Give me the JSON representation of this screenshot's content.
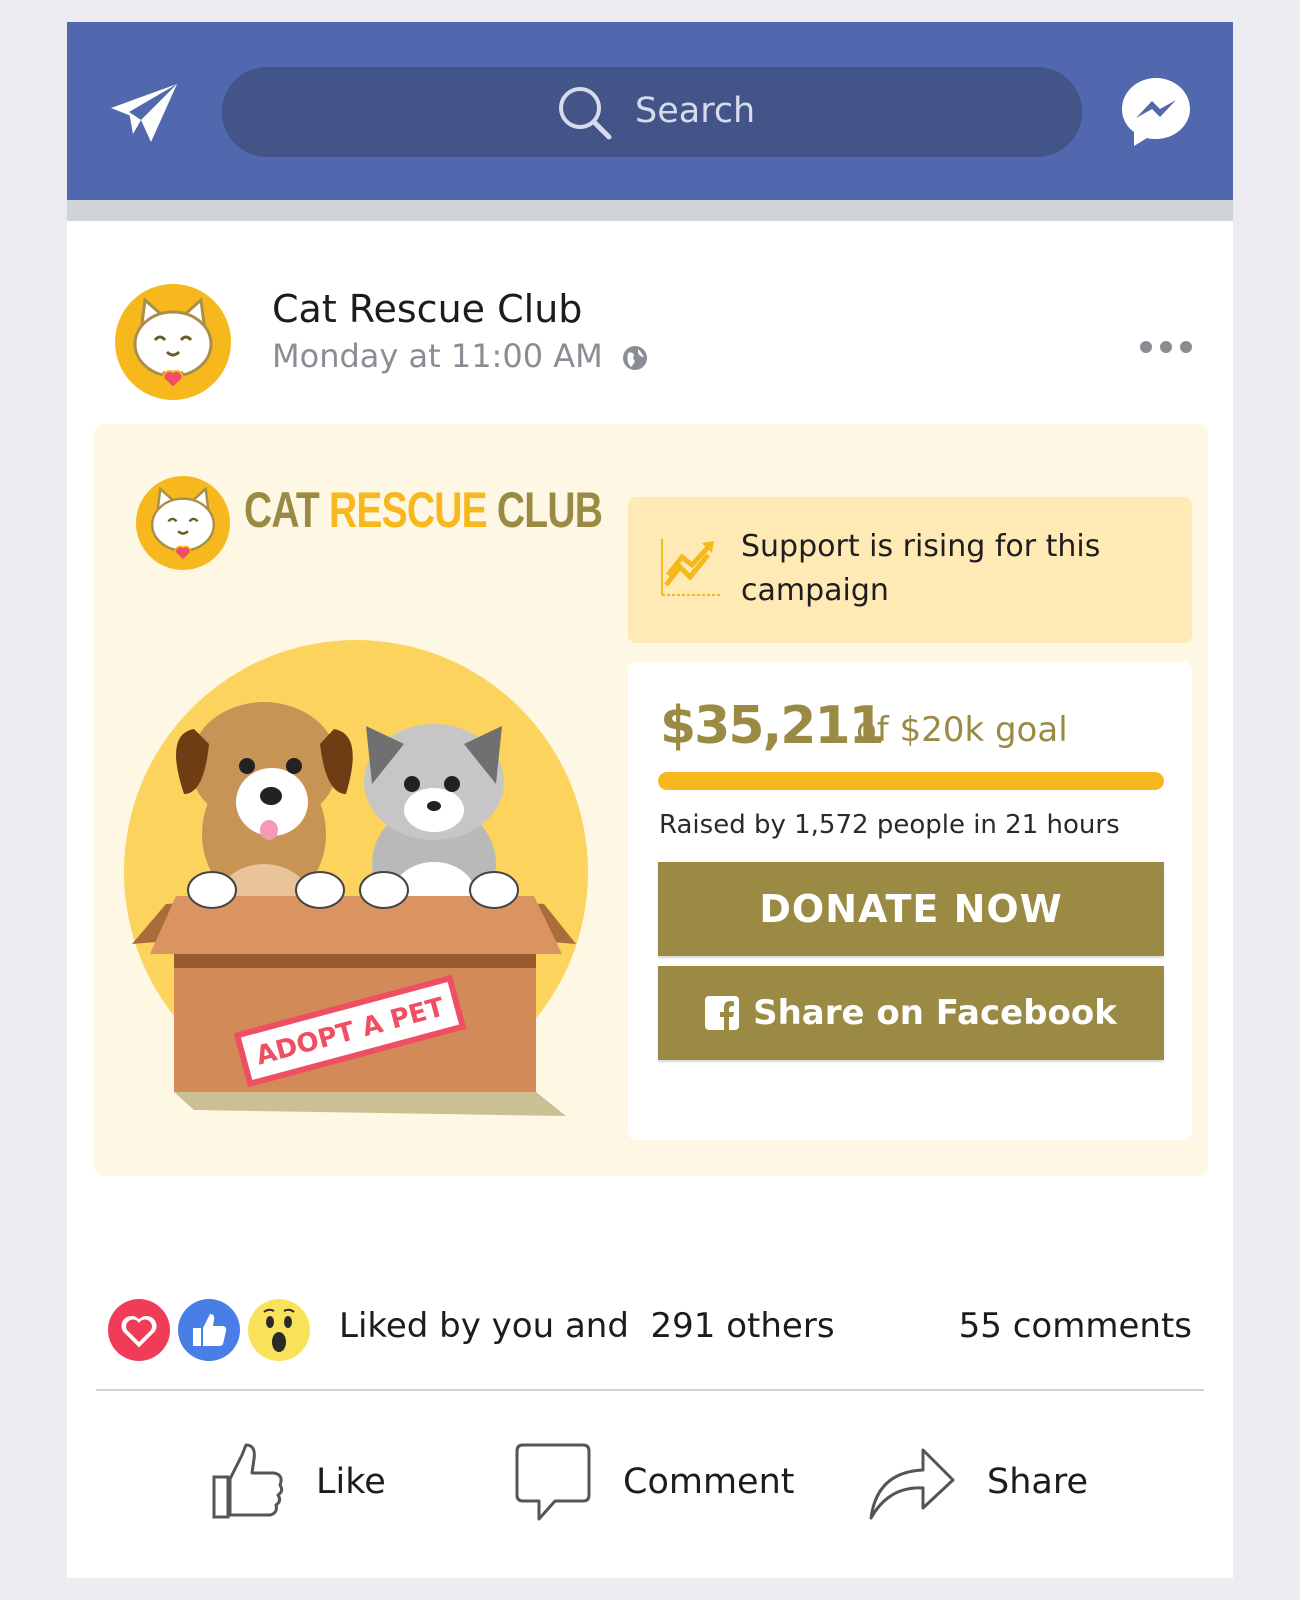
{
  "topbar": {
    "search_placeholder": "Search"
  },
  "post": {
    "page_name": "Cat Rescue Club",
    "timestamp": "Monday at 11:00 AM"
  },
  "banner": {
    "brand_word1": "CAT",
    "brand_word2": "RESCUE",
    "brand_word3": "CLUB",
    "stamp_text": "ADOPT A PET",
    "rising_text": "Support is rising for this campaign",
    "amount": "$35,211",
    "goal": "of $20k goal",
    "progress_fraction": 1.0,
    "raised_text": "Raised by 1,572 people in 21 hours",
    "donate_label": "DONATE NOW",
    "share_fb_label": "Share on Facebook"
  },
  "engagement": {
    "liked_text": "Liked by you and  291 others",
    "comments_text": "55 comments"
  },
  "actions": {
    "like": "Like",
    "comment": "Comment",
    "share": "Share"
  },
  "colors": {
    "header": "#5168ae",
    "accent": "#9b8a43",
    "progress": "#f6b81c",
    "banner_bg": "#fef7e4"
  },
  "icons": [
    "send-icon",
    "search-icon",
    "messenger-icon",
    "globe-icon",
    "more-icon",
    "trend-icon",
    "facebook-icon",
    "love-reaction-icon",
    "like-reaction-icon",
    "wow-reaction-icon",
    "like-icon",
    "comment-icon",
    "share-icon"
  ]
}
